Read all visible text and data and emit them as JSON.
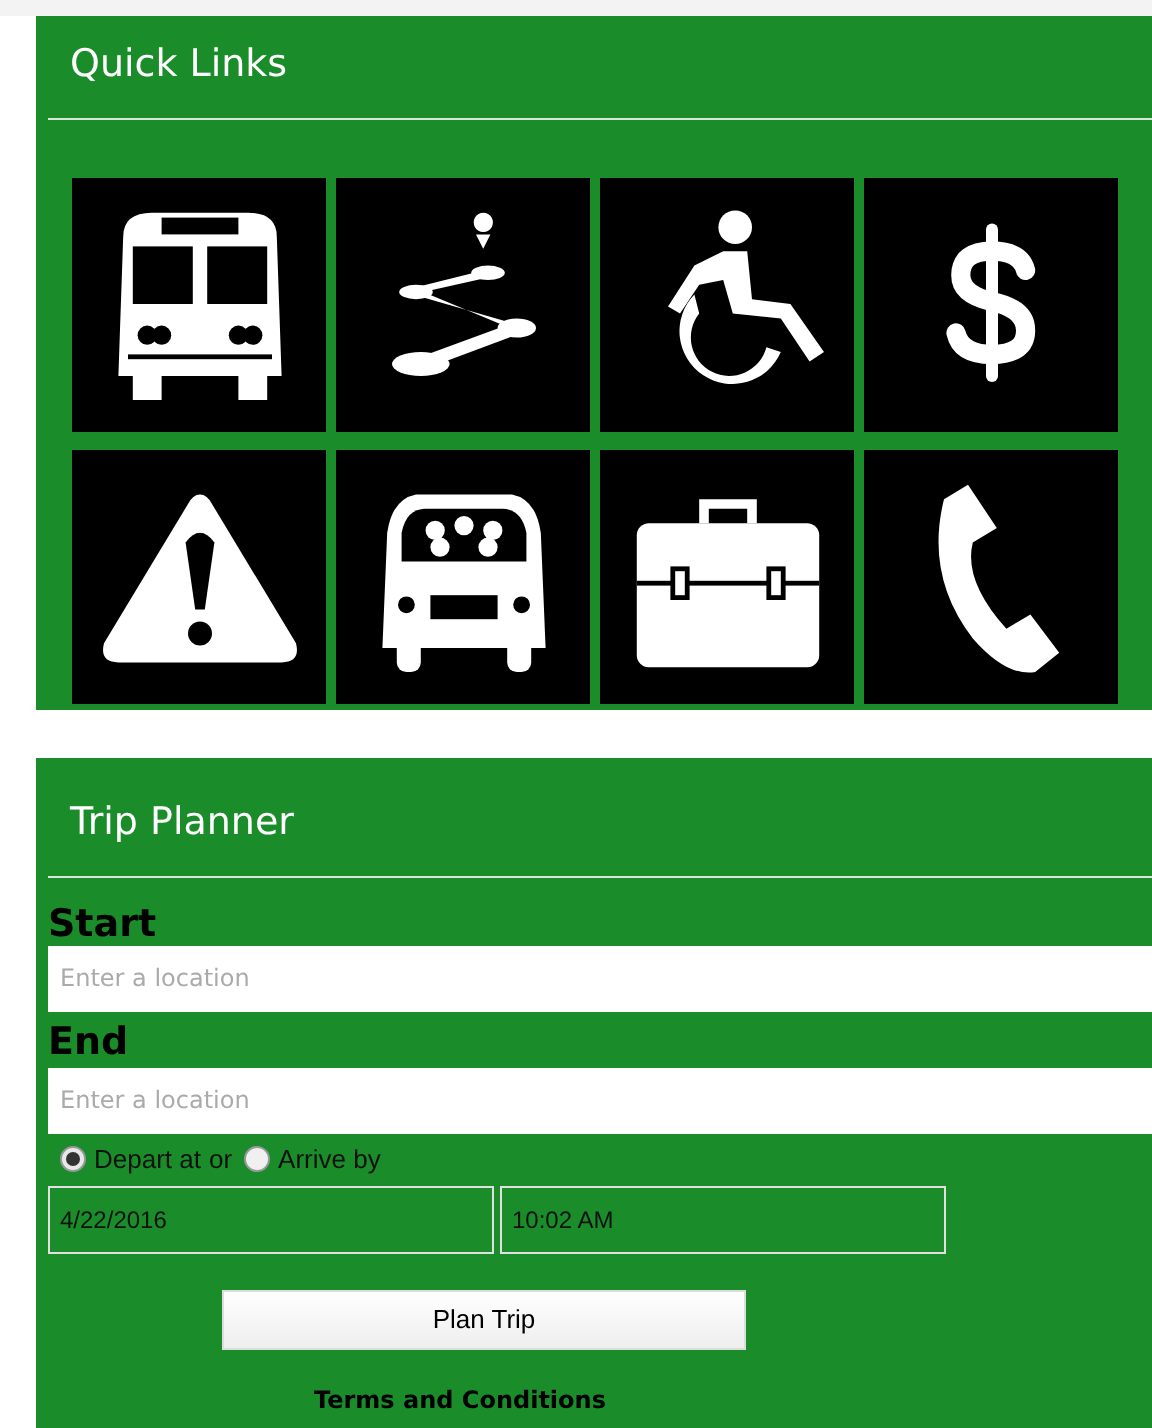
{
  "quick_links": {
    "title": "Quick Links"
  },
  "trip_planner": {
    "title": "Trip Planner",
    "start": {
      "label": "Start",
      "placeholder": "Enter a location"
    },
    "end": {
      "label": "End",
      "placeholder": "Enter a location"
    },
    "time_options": [
      {
        "label": "Depart at",
        "selected": true
      },
      {
        "label": "Arrive by",
        "selected": false
      }
    ],
    "separator": "or",
    "date": "4/22/2016",
    "time": "10:02 AM",
    "button": "Plan Trip",
    "terms_link": "Terms and Conditions"
  }
}
